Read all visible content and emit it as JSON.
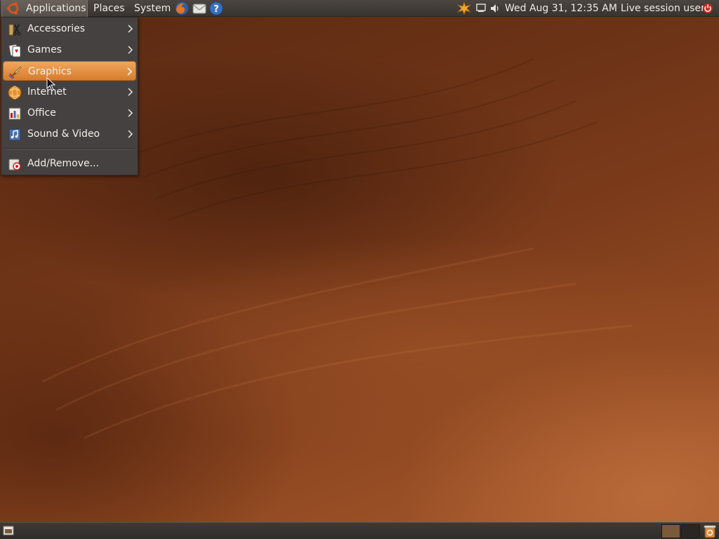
{
  "top_panel": {
    "menus": [
      {
        "label": "Applications",
        "icon": "ubuntu-logo-icon"
      },
      {
        "label": "Places"
      },
      {
        "label": "System"
      }
    ],
    "launchers": [
      "firefox-icon",
      "mail-icon",
      "help-icon"
    ],
    "tray_icons": [
      "update-notifier-icon",
      "network-icon",
      "volume-icon"
    ],
    "clock": "Wed Aug 31, 12:35 AM",
    "user": "Live session user",
    "session_icon": "power-icon"
  },
  "applications_menu": {
    "items": [
      {
        "label": "Accessories",
        "icon": "accessories-icon",
        "has_submenu": true
      },
      {
        "label": "Games",
        "icon": "games-icon",
        "has_submenu": true
      },
      {
        "label": "Graphics",
        "icon": "graphics-icon",
        "has_submenu": true,
        "highlighted": true
      },
      {
        "label": "Internet",
        "icon": "internet-icon",
        "has_submenu": true
      },
      {
        "label": "Office",
        "icon": "office-icon",
        "has_submenu": true
      },
      {
        "label": "Sound & Video",
        "icon": "sound-video-icon",
        "has_submenu": true
      }
    ],
    "footer_item": {
      "label": "Add/Remove...",
      "icon": "add-remove-icon"
    }
  },
  "bottom_panel": {
    "show_desktop_icon": "show-desktop-icon",
    "workspaces": 2,
    "active_workspace": 1,
    "trash_icon": "trash-icon"
  },
  "colors": {
    "panel": "#3d3935",
    "menu_bg": "#454140",
    "highlight": "#e08a3a",
    "wallpaper": "#7d3c1b"
  }
}
